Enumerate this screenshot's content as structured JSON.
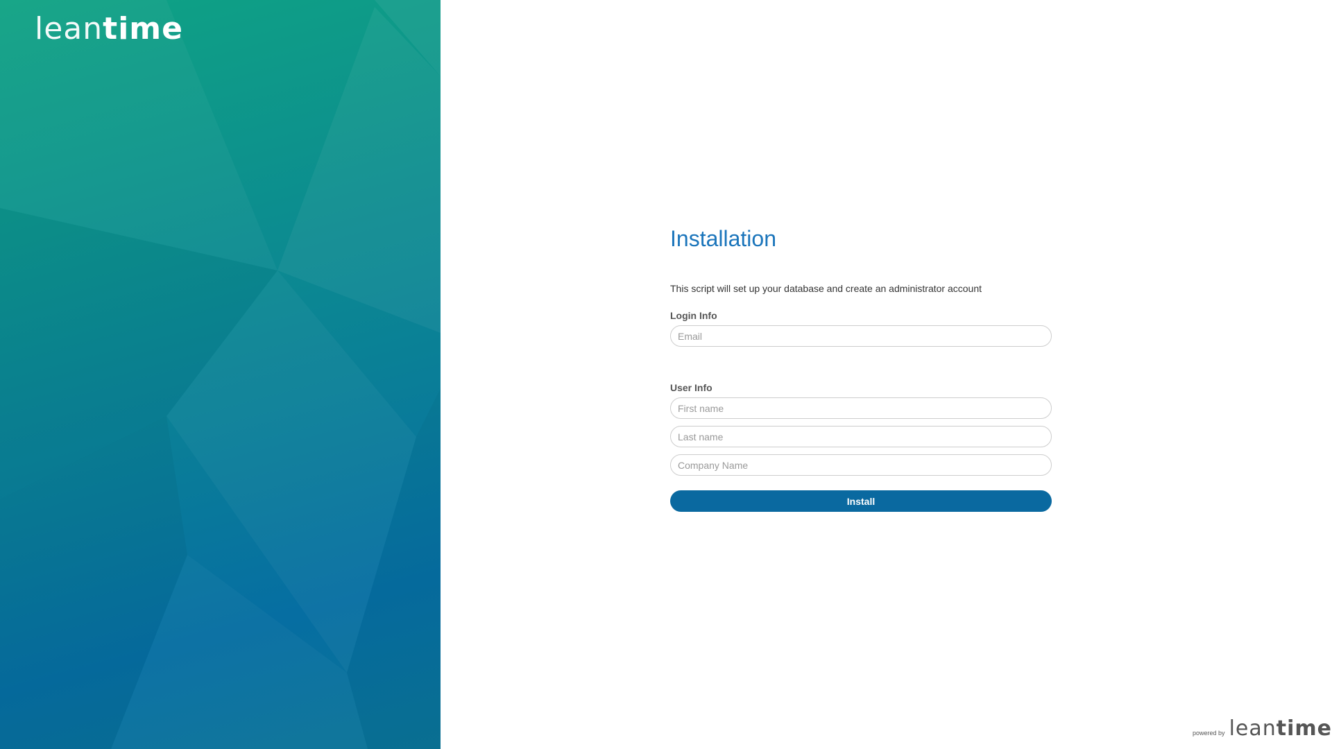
{
  "brand": {
    "logo_light": "lean",
    "logo_bold": "time",
    "primary_color": "#1b75bb",
    "button_color": "#0a69a0"
  },
  "form": {
    "title": "Installation",
    "intro": "This script will set up your database and create an administrator account",
    "login_section_label": "Login Info",
    "email_placeholder": "Email",
    "user_section_label": "User Info",
    "firstname_placeholder": "First name",
    "lastname_placeholder": "Last name",
    "company_placeholder": "Company Name",
    "install_label": "Install"
  },
  "footer": {
    "powered_by": "powered by",
    "logo_light": "lean",
    "logo_bold": "time"
  }
}
